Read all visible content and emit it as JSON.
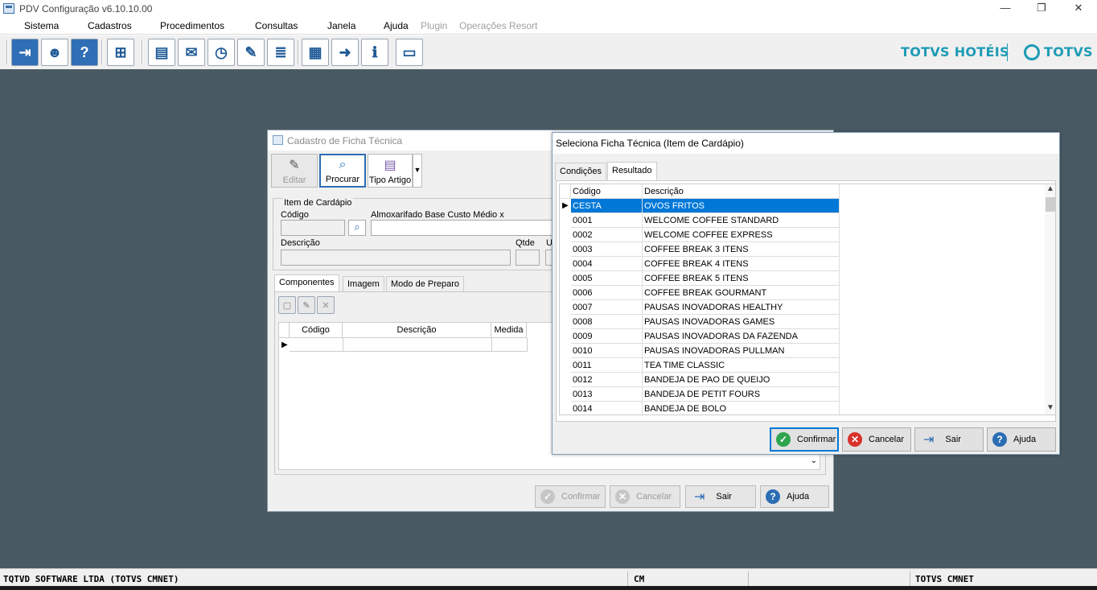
{
  "window": {
    "title": "PDV Configuração v6.10.10.00",
    "minimize": "—",
    "maximize": "❐",
    "close": "✕"
  },
  "menu": [
    "Sistema",
    "Cadastros",
    "Procedimentos",
    "Consultas",
    "Janela",
    "Ajuda",
    "Plugin",
    "Operações Resort"
  ],
  "toolbar": {
    "icons": [
      "exit-icon",
      "user-key-icon",
      "help-icon",
      "network-icon",
      "cash-register-icon",
      "mail-icon",
      "clock-icon",
      "edit-list-icon",
      "notes-money-icon",
      "calculator-icon",
      "mail-forward-icon",
      "monitor-info-icon",
      "card-icon"
    ]
  },
  "brand": {
    "name": "TOTVS HOTÉIS",
    "logo_text": "TOTVS",
    "color": "#1d9bb5"
  },
  "status": {
    "company": "TQTVD SOFTWARE LTDA (TOTVS CMNET)",
    "cell2": "CM",
    "cell3": "TOTVS CMNET"
  },
  "back_dialog": {
    "title": "Cadastro de Ficha Técnica",
    "btn_edit": "Editar",
    "btn_search": "Procurar",
    "btn_type": "Tipo Artigo",
    "group_title": "Item de Cardápio",
    "lbl_code": "Código",
    "lbl_store": "Almoxarifado Base Custo Médio x",
    "lbl_desc": "Descrição",
    "lbl_qty": "Qtde",
    "lbl_u": "U",
    "tabs": [
      "Componentes",
      "Imagem",
      "Modo de Preparo"
    ],
    "grid_cols": [
      "Código",
      "Descrição",
      "Medida"
    ],
    "btn_confirm": "Confirmar",
    "btn_cancel": "Cancelar",
    "btn_exit": "Sair",
    "btn_help": "Ajuda"
  },
  "front_dialog": {
    "title": "Seleciona Ficha Técnica (Item de Cardápio)",
    "tabs": [
      "Condições",
      "Resultado"
    ],
    "col_code": "Código",
    "col_desc": "Descrição",
    "rows": [
      {
        "code": "CESTA",
        "desc": "OVOS FRITOS"
      },
      {
        "code": "0001",
        "desc": "WELCOME COFFEE STANDARD"
      },
      {
        "code": "0002",
        "desc": "WELCOME COFFEE EXPRESS"
      },
      {
        "code": "0003",
        "desc": "COFFEE BREAK 3 ITENS"
      },
      {
        "code": "0004",
        "desc": "COFFEE BREAK 4 ITENS"
      },
      {
        "code": "0005",
        "desc": "COFFEE BREAK 5 ITENS"
      },
      {
        "code": "0006",
        "desc": "COFFEE BREAK GOURMANT"
      },
      {
        "code": "0007",
        "desc": "PAUSAS INOVADORAS HEALTHY"
      },
      {
        "code": "0008",
        "desc": "PAUSAS INOVADORAS GAMES"
      },
      {
        "code": "0009",
        "desc": "PAUSAS INOVADORAS DA FAZENDA"
      },
      {
        "code": "0010",
        "desc": "PAUSAS INOVADORAS PULLMAN"
      },
      {
        "code": "0011",
        "desc": "TEA TIME CLASSIC"
      },
      {
        "code": "0012",
        "desc": "BANDEJA DE PAO DE QUEIJO"
      },
      {
        "code": "0013",
        "desc": "BANDEJA DE PETIT FOURS"
      },
      {
        "code": "0014",
        "desc": "BANDEJA DE BOLO"
      }
    ],
    "btn_confirm": "Confirmar",
    "btn_cancel": "Cancelar",
    "btn_exit": "Sair",
    "btn_help": "Ajuda"
  }
}
